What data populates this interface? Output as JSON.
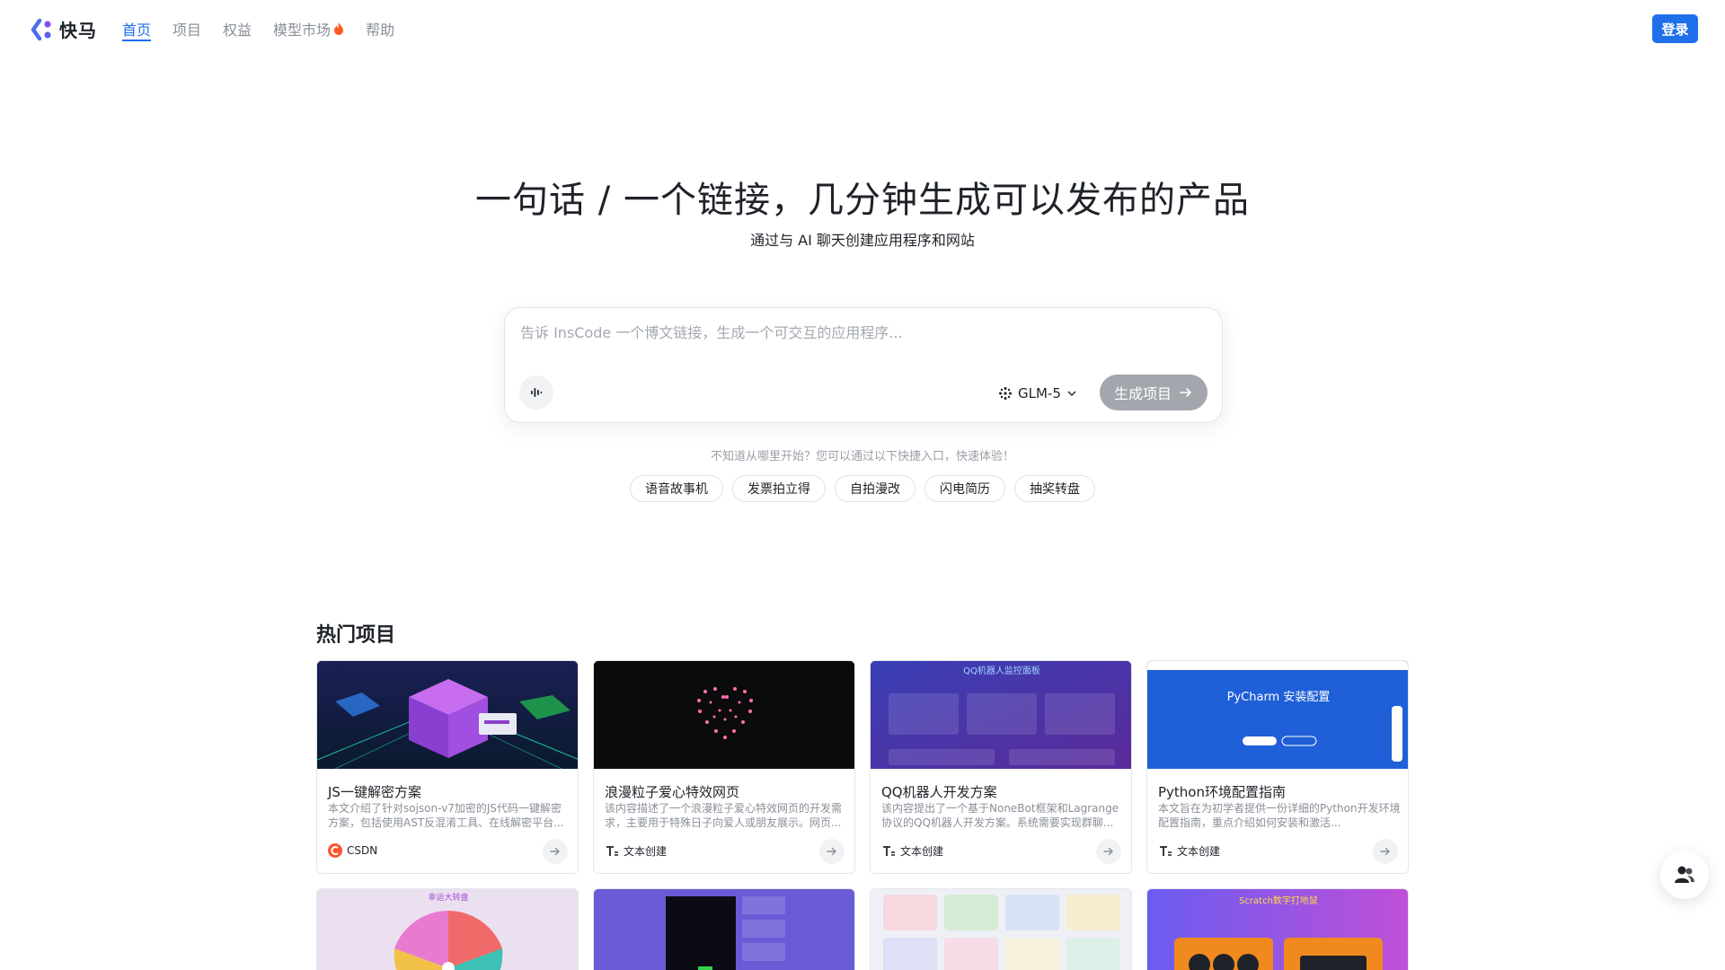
{
  "brand": {
    "name": "快马"
  },
  "nav": [
    {
      "label": "首页",
      "active": true
    },
    {
      "label": "项目",
      "active": false
    },
    {
      "label": "权益",
      "active": false
    },
    {
      "label": "模型市场",
      "active": false,
      "icon": "fire-icon"
    },
    {
      "label": "帮助",
      "active": false
    }
  ],
  "header": {
    "login_label": "登录"
  },
  "hero": {
    "title": "一句话 / 一个链接，几分钟生成可以发布的产品",
    "subtitle": "通过与 AI 聊天创建应用程序和网站"
  },
  "prompt": {
    "placeholder": "告诉 InsCode 一个博文链接，生成一个可交互的应用程序...",
    "value": "",
    "model": "GLM-5",
    "generate_label": "生成项目"
  },
  "quickstart": {
    "hint": "不知道从哪里开始？您可以通过以下快捷入口，快速体验！",
    "chips": [
      "语音故事机",
      "发票拍立得",
      "自拍漫改",
      "闪电简历",
      "抽奖转盘"
    ]
  },
  "projects": {
    "title": "热门项目",
    "items": [
      {
        "title": "JS一键解密方案",
        "desc": "本文介绍了针对sojson-v7加密的JS代码一键解密方案，包括使用AST反混淆工具、在线解密平台...",
        "source": "CSDN"
      },
      {
        "title": "浪漫粒子爱心特效网页",
        "desc": "该内容描述了一个浪漫粒子爱心特效网页的开发需求，主要用于特殊日子向爱人或朋友展示。网页...",
        "source": "文本创建"
      },
      {
        "title": "QQ机器人开发方案",
        "desc": "该内容提出了一个基于NoneBot框架和Lagrange协议的QQ机器人开发方案。系统需要实现群聊...",
        "source": "文本创建"
      },
      {
        "title": "Python环境配置指南",
        "desc": "本文旨在为初学者提供一份详细的Python开发环境配置指南，重点介绍如何安装和激活...",
        "source": "文本创建"
      }
    ],
    "thumb_text": {
      "qq_title": "QQ机器人监控面板",
      "pycharm_title": "PyCharm 安装配置",
      "wheel_title": "幸运大转盘",
      "scratch_title": "Scratch数字打地鼠"
    }
  },
  "colors": {
    "accent": "#1f6feb",
    "button_disabled": "#a3a6ad"
  }
}
